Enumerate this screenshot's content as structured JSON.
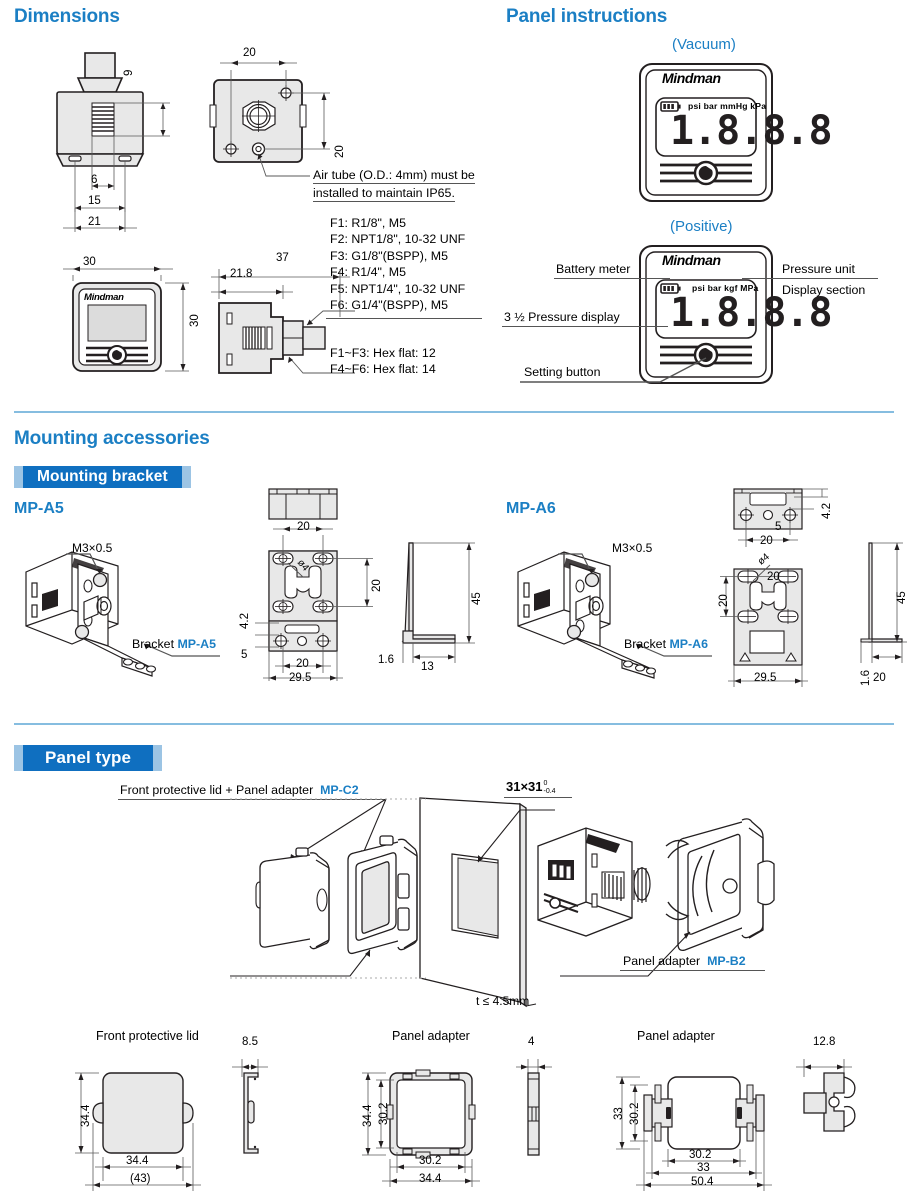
{
  "sections": {
    "dimensions_title": "Dimensions",
    "panel_instructions_title": "Panel instructions",
    "mounting_accessories_title": "Mounting accessories",
    "mounting_bracket_badge": "Mounting bracket",
    "panel_type_badge": "Panel type"
  },
  "colors": {
    "heading_blue": "#1b7fc4",
    "badge_blue": "#0f6fc0",
    "badge_cap_blue": "#9cc4e4",
    "divider_blue": "#86bde0",
    "drawing_fill": "#e8e8e8",
    "line": "#231f20"
  },
  "dimensions": {
    "front_view": {
      "d9": "9",
      "d6": "6",
      "d15": "15",
      "d21": "21"
    },
    "top_view": {
      "d20_w": "20",
      "d20_h": "20"
    },
    "air_note_line1": "Air tube (O.D.: 4mm) must be",
    "air_note_line2": "installed to maintain IP65.",
    "face_view": {
      "brand": "Mindman",
      "d30_w": "30",
      "d30_h": "30"
    },
    "side_view": {
      "d37": "37",
      "d21_8": "21.8"
    },
    "port_options": [
      "F1: R1/8\", M5",
      "F2: NPT1/8\", 10-32 UNF",
      "F3: G1/8\"(BSPP), M5",
      "F4: R1/4\", M5",
      "F5: NPT1/4\", 10-32 UNF",
      "F6: G1/4\"(BSPP), M5"
    ],
    "hex_notes": [
      "F1~F3: Hex flat: 12",
      "F4~F6: Hex flat: 14"
    ]
  },
  "panel_instructions": {
    "vacuum_label": "(Vacuum)",
    "positive_label": "(Positive)",
    "gauge_brand": "Mindman",
    "vacuum_units": "psi bar mmHg kPa",
    "positive_units": "psi bar kgf MPa",
    "display_digits": "1.8.8.8",
    "callouts": {
      "battery_meter": "Battery meter",
      "pressure_display": "3 ½ Pressure display",
      "setting_button": "Setting button",
      "pressure_unit": "Pressure unit",
      "display_section": "Display section"
    }
  },
  "mounting": {
    "mp_a5": {
      "part": "MP-A5",
      "thread": "M3×0.5",
      "bracket_label_prefix": "Bracket ",
      "bracket_label_part": "MP-A5",
      "dims": {
        "d20_top": "20",
        "dia4": "ø4",
        "d20_right": "20",
        "d4_2": "4.2",
        "d5": "5",
        "d20_bottom": "20",
        "d29_5": "29.5",
        "d45": "45",
        "d1_6": "1.6",
        "d13": "13"
      }
    },
    "mp_a6": {
      "part": "MP-A6",
      "thread": "M3×0.5",
      "bracket_label_prefix": "Bracket ",
      "bracket_label_part": "MP-A6",
      "dims": {
        "d4_2": "4.2",
        "d5": "5",
        "d20_top": "20",
        "dia4": "ø4",
        "d20_mid": "20",
        "d20_left": "20",
        "d29_5": "29.5",
        "d45": "45",
        "d1_6": "1.6",
        "d20_bottom": "20"
      }
    }
  },
  "panel_type": {
    "lid_adapter_label": "Front protective lid + Panel adapter",
    "lid_adapter_part": "MP-C2",
    "cutout_dim": "31×31",
    "cutout_tol_upper": "0",
    "cutout_tol_lower": "-0.4",
    "panel_adapter_label": "Panel adapter",
    "panel_adapter_part": "MP-B2",
    "thickness_note": "t ≤ 4.5mm",
    "details": {
      "lid": {
        "title": "Front protective lid",
        "h34_4": "34.4",
        "w34_4": "34.4",
        "w43": "(43)",
        "thk8_5": "8.5"
      },
      "adapter_front": {
        "title": "Panel adapter",
        "h34_4": "34.4",
        "h30_2": "30.2",
        "w30_2": "30.2",
        "w34_4": "34.4",
        "thk4": "4"
      },
      "adapter_clip": {
        "title": "Panel adapter",
        "h33": "33",
        "h30_2": "30.2",
        "w30_2": "30.2",
        "w33": "33",
        "w50_4": "50.4",
        "thk12_8": "12.8"
      }
    }
  }
}
